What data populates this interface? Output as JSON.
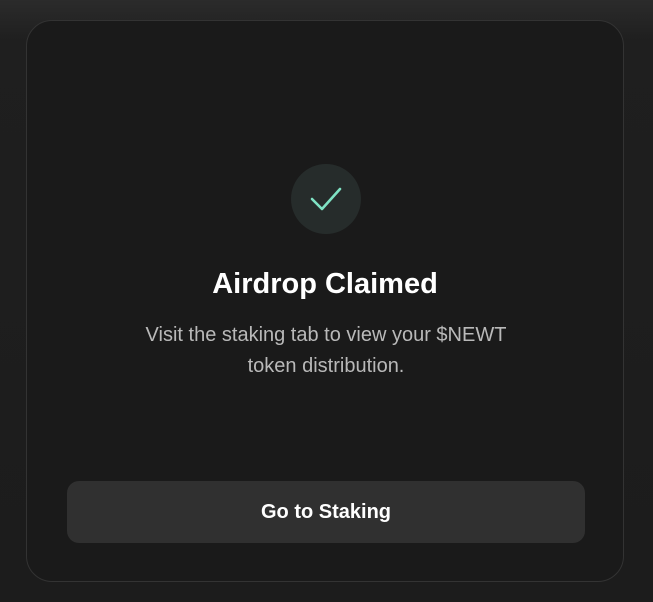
{
  "dialog": {
    "title": "Airdrop Claimed",
    "description": "Visit the staking tab to view your $NEWT token distribution.",
    "primary_button_label": "Go to Staking",
    "icon": "check-icon"
  },
  "colors": {
    "background": "#1a1a1a",
    "card_border": "#333333",
    "icon_circle": "#262c2b",
    "check": "#7fe3c4",
    "title_text": "#ffffff",
    "body_text": "#b9b9b9",
    "button_bg": "#303030"
  }
}
